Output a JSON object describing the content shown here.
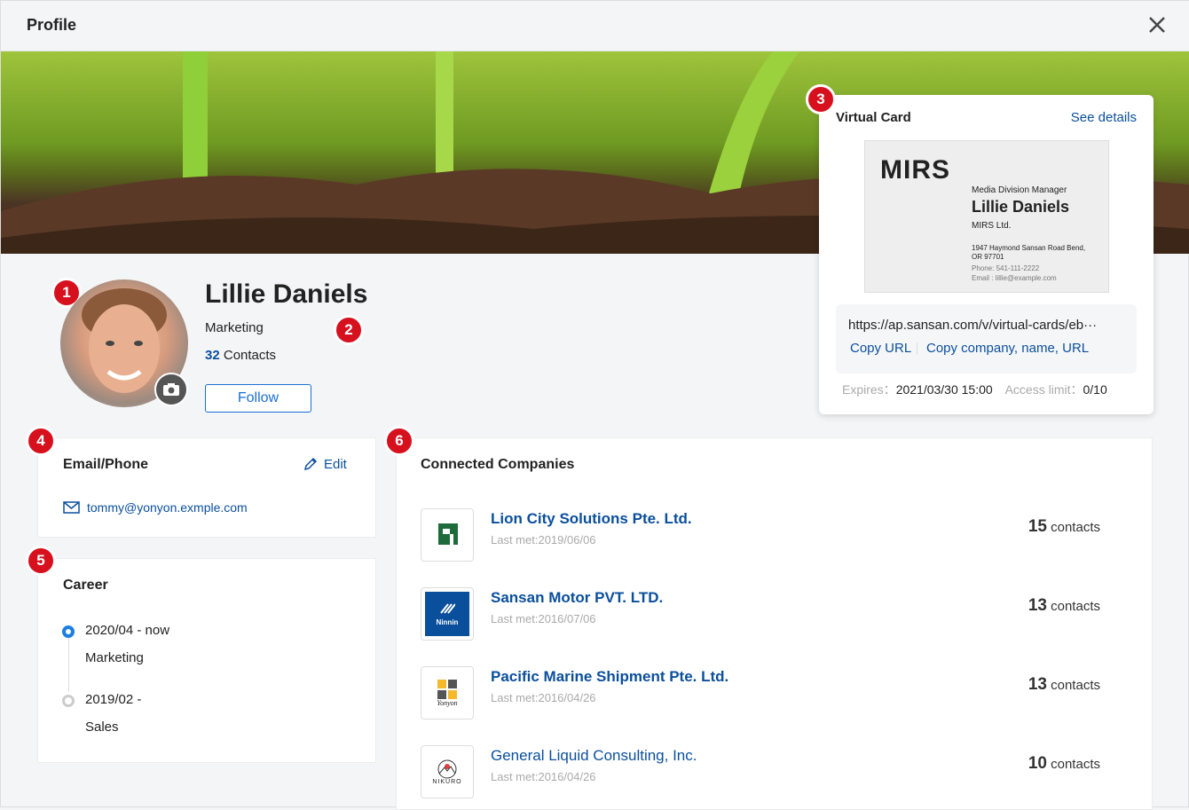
{
  "header": {
    "title": "Profile"
  },
  "badges": [
    "1",
    "2",
    "3",
    "4",
    "5",
    "6"
  ],
  "profile": {
    "name": "Lillie Daniels",
    "department": "Marketing",
    "contacts_count": "32",
    "contacts_label": "Contacts",
    "follow_label": "Follow"
  },
  "virtual_card": {
    "title": "Virtual Card",
    "see_details": "See details",
    "card": {
      "logo": "MIRS",
      "job_title": "Media Division Manager",
      "name": "Lillie Daniels",
      "company": "MIRS Ltd.",
      "address1": "1947 Haymond Sansan Road Bend,",
      "address2": "OR 97701",
      "phone": "Phone: 541-111-2222",
      "email": "Email : lillie@example.com"
    },
    "url": "https://ap.sansan.com/v/virtual-cards/eb···",
    "copy_url": "Copy URL",
    "copy_all": "Copy company, name, URL",
    "expires_label": "Expires：",
    "expires": "2021/03/30 15:00",
    "access_label": "Access limit：",
    "access": "0/10"
  },
  "email_phone": {
    "title": "Email/Phone",
    "edit": "Edit",
    "email": "tommy@yonyon.exmple.com"
  },
  "career": {
    "title": "Career",
    "items": [
      {
        "period": "2020/04 - now",
        "role": "Marketing",
        "current": true
      },
      {
        "period": "2019/02 -",
        "role": "Sales",
        "current": false
      }
    ]
  },
  "companies": {
    "title": "Connected Companies",
    "contacts_label": "contacts",
    "items": [
      {
        "name": "Lion City Solutions Pte. Ltd.",
        "last_met": "Last met:2019/06/06",
        "count": "15"
      },
      {
        "name": "Sansan Motor PVT. LTD.",
        "last_met": "Last met:2016/07/06",
        "count": "13",
        "logo_text": "Ninnin"
      },
      {
        "name": "Pacific Marine Shipment Pte. Ltd.",
        "last_met": "Last met:2016/04/26",
        "count": "13",
        "logo_text": "Yonyon"
      },
      {
        "name": "General Liquid Consulting, Inc.",
        "last_met": "Last met:2016/04/26",
        "count": "10",
        "logo_text": "NIKURO"
      }
    ]
  },
  "colors": {
    "accent": "#0a4f9c",
    "badge": "#d7101e"
  }
}
